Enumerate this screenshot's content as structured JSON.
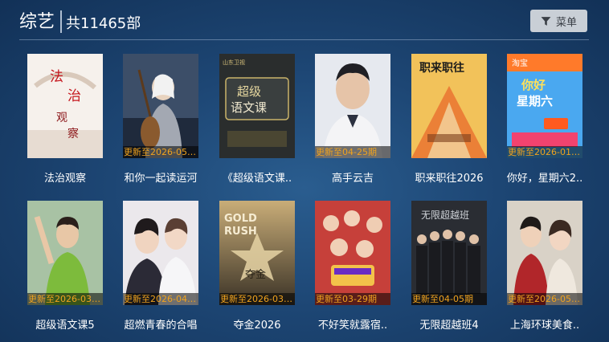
{
  "header": {
    "category": "综艺",
    "count_text": "共11465部",
    "menu_label": "菜单",
    "menu_icon": "filter-icon"
  },
  "items": [
    {
      "title": "法治观察",
      "update": "",
      "poster_text": "法 治 观 察",
      "palette": [
        "#f7f3ef",
        "#c8181e"
      ]
    },
    {
      "title": "和你一起读运河",
      "update": "更新至2026-05-0..",
      "poster_text": "",
      "palette": [
        "#3a4b66",
        "#d9d2c9"
      ]
    },
    {
      "title": "《超级语文课..",
      "update": "",
      "poster_text": "超级 语文课",
      "palette": [
        "#2b2e2e",
        "#d6c07a"
      ]
    },
    {
      "title": "高手云吉",
      "update": "更新至04-25期",
      "poster_text": "",
      "palette": [
        "#e8eaf0",
        "#2c3140"
      ]
    },
    {
      "title": "职来职往2026",
      "update": "",
      "poster_text": "职来职往",
      "palette": [
        "#f3c35a",
        "#e85a2c"
      ]
    },
    {
      "title": "你好，星期六2..",
      "update": "更新至2026-01-2..",
      "poster_text": "你好 星期六",
      "palette": [
        "#4aa8f0",
        "#f2436f"
      ]
    },
    {
      "title": "超级语文课5",
      "update": "更新至2026-03-2..",
      "poster_text": "",
      "palette": [
        "#a8c7a0",
        "#7dbb3c"
      ]
    },
    {
      "title": "超燃青春的合唱",
      "update": "更新至2026-04-2..",
      "poster_text": "",
      "palette": [
        "#e9e6ea",
        "#2b2a36"
      ]
    },
    {
      "title": "夺金2026",
      "update": "更新至2026-03-0..",
      "poster_text": "GOLD RUSH 夺金",
      "palette": [
        "#b79a63",
        "#3a3226"
      ]
    },
    {
      "title": "不好笑就露宿..",
      "update": "更新至03-29期",
      "poster_text": "",
      "palette": [
        "#d24a3e",
        "#f3c24a"
      ]
    },
    {
      "title": "无限超越班4",
      "update": "更新至04-05期",
      "poster_text": "无限超越班",
      "palette": [
        "#2a2d33",
        "#9aa0a8"
      ]
    },
    {
      "title": "上海环球美食..",
      "update": "更新至2026-05-0..",
      "poster_text": "",
      "palette": [
        "#d8d1c6",
        "#b1262a"
      ]
    }
  ]
}
